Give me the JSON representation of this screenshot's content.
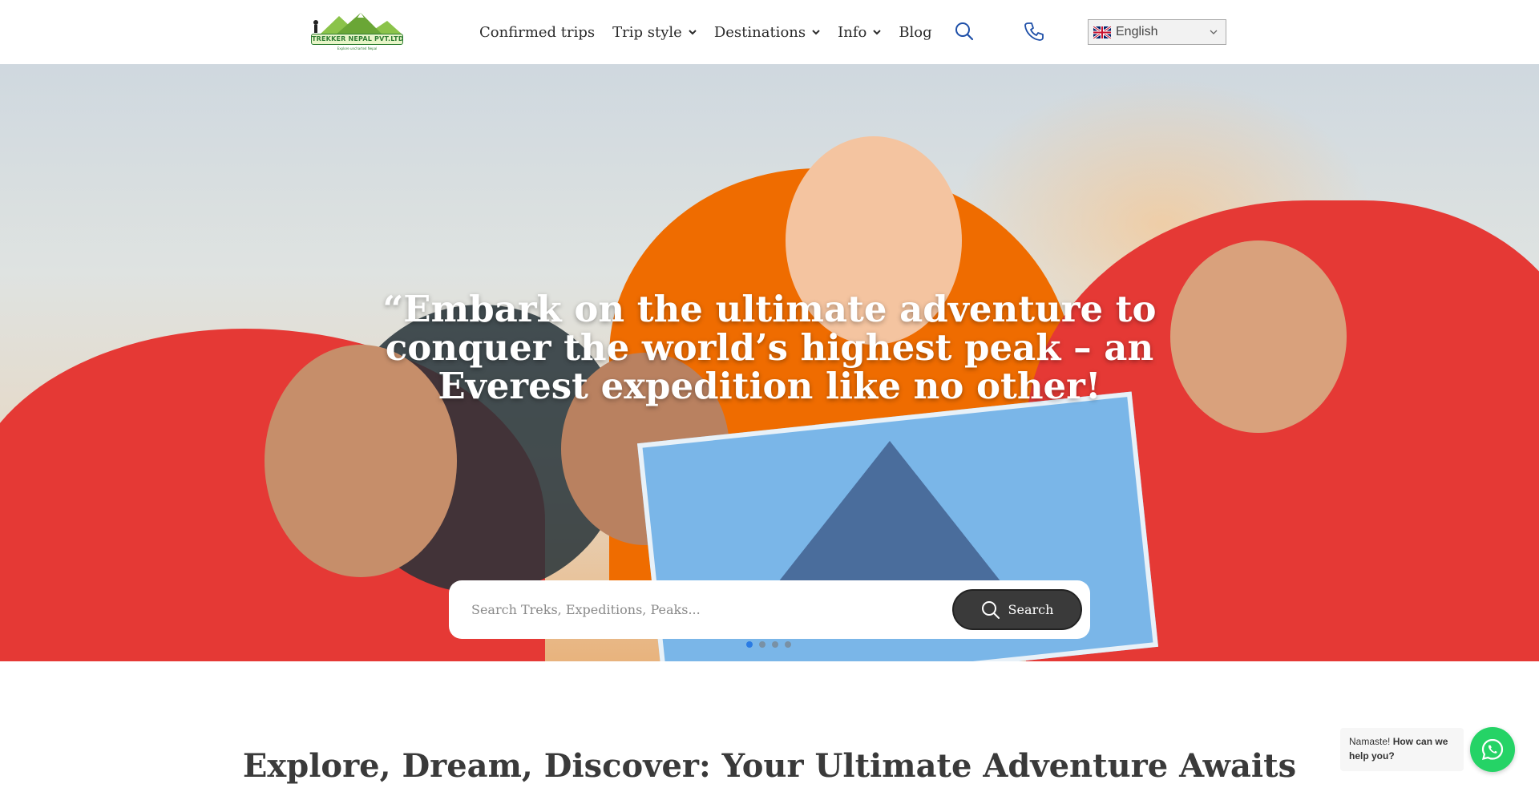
{
  "header": {
    "logo_text": "TREKKER NEPAL PVT.LTD",
    "logo_tagline": "Explore uncharted Nepal",
    "nav": [
      {
        "label": "Confirmed trips",
        "has_dropdown": false
      },
      {
        "label": "Trip style",
        "has_dropdown": true
      },
      {
        "label": "Destinations",
        "has_dropdown": true
      },
      {
        "label": "Info",
        "has_dropdown": true
      },
      {
        "label": "Blog",
        "has_dropdown": false
      }
    ],
    "icons": {
      "search": "search-icon",
      "phone": "phone-icon"
    },
    "language": {
      "selected": "English",
      "flag": "uk-flag-icon"
    }
  },
  "hero": {
    "title": "“Embark on the ultimate adventure to conquer the world’s highest peak – an Everest expedition like no other!",
    "search": {
      "placeholder": "Search Treks, Expeditions, Peaks...",
      "button_label": "Search"
    },
    "slides_count": 4,
    "active_slide": 1
  },
  "section": {
    "title": "Explore, Dream, Discover: Your Ultimate Adventure Awaits"
  },
  "whatsapp": {
    "greeting": "Namaste!",
    "prompt": "How can we help you?"
  },
  "colors": {
    "accent": "#2a7be4",
    "search_button": "#3a3a3a",
    "whatsapp": "#25d366",
    "logo_green": "#2e7d32"
  }
}
